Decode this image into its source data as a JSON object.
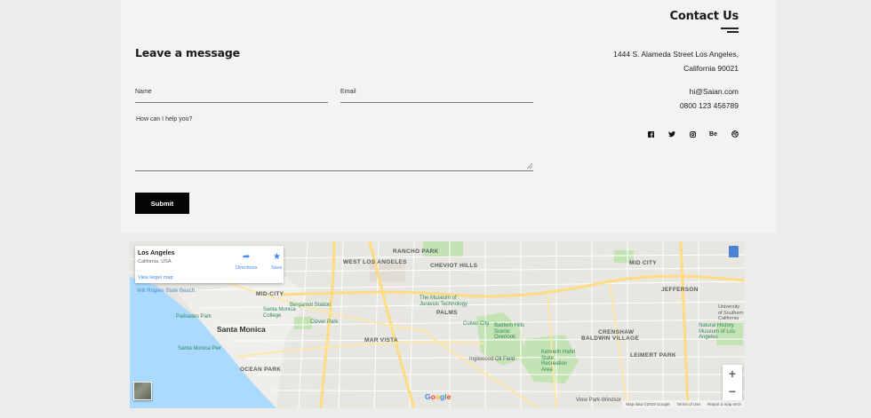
{
  "form": {
    "heading": "Leave a message",
    "name_label": "Name",
    "email_label": "Email",
    "message_label": "How can I help you?",
    "submit_label": "Submit"
  },
  "contact": {
    "heading": "Contact Us",
    "address_line1": "1444 S. Alameda Street Los Angeles,",
    "address_line2": "California 90021",
    "email": "hi@Saian.com",
    "phone": "0800 123 456789",
    "social": [
      {
        "icon": "facebook-icon",
        "text": "f"
      },
      {
        "icon": "twitter-icon",
        "text": ""
      },
      {
        "icon": "instagram-icon",
        "text": ""
      },
      {
        "icon": "behance-icon",
        "text": "Be"
      },
      {
        "icon": "dribbble-icon",
        "text": ""
      }
    ]
  },
  "map": {
    "place_title": "Los Angeles",
    "place_sub": "California, USA",
    "directions_label": "Directions",
    "save_label": "Save",
    "larger_map_label": "View larger map",
    "zoom_in": "+",
    "zoom_out": "−",
    "google_logo": "Google",
    "footer": {
      "data": "Map data ©2019 Google",
      "terms": "Terms of Use",
      "report": "Report a map error"
    },
    "labels": {
      "santa_monica": "Santa Monica",
      "west_los_angeles": "WEST LOS ANGELES",
      "rancho_park": "RANCHO PARK",
      "cheviot_hills": "CHEVIOT HILLS",
      "mid_city": "MID-CITY",
      "mid_city_w": "MID CITY",
      "palms": "PALMS",
      "mar_vista": "MAR VISTA",
      "ocean_park": "OCEAN PARK",
      "crenshaw": "CRENSHAW",
      "baldwin_village": "BALDWIN VILLAGE",
      "leimert_park": "LEIMERT PARK",
      "jefferson": "JEFFERSON",
      "culver_city": "Culver City",
      "will_rogers": "Will Rogers State Beach",
      "palisades_park": "Palisades Park",
      "santa_monica_pier": "Santa Monica Pier",
      "clover_park": "Clover Park",
      "bergamot": "Bergamot Station",
      "smc": "Santa Monica College",
      "museum_jurassic": "The Museum of Jurassic Technology",
      "baldwin_hills": "Baldwin Hills Scenic Overlook",
      "inglewood_oil": "Inglewood Oil Field",
      "kenneth_hahn": "Kenneth Hahn State Recreation Area",
      "natural_history": "Natural History Museum of Los Angeles",
      "usc": "University of Southern California",
      "view_park": "View Park-Windsor"
    }
  }
}
